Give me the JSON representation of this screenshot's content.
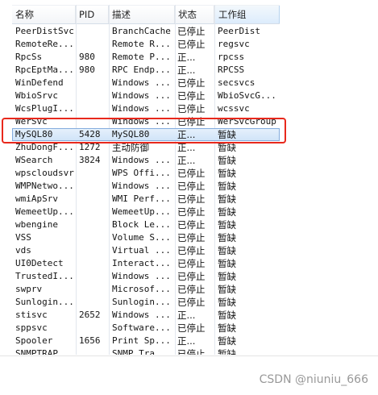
{
  "columns": {
    "name": "名称",
    "pid": "PID",
    "desc": "描述",
    "status": "状态",
    "group": "工作组"
  },
  "services": [
    {
      "name": "PeerDistSvc",
      "pid": "",
      "desc": "BranchCache",
      "status": "已停止",
      "group": "PeerDist"
    },
    {
      "name": "RemoteRe...",
      "pid": "",
      "desc": "Remote R...",
      "status": "已停止",
      "group": "regsvc"
    },
    {
      "name": "RpcSs",
      "pid": "980",
      "desc": "Remote P...",
      "status": "正...",
      "group": "rpcss"
    },
    {
      "name": "RpcEptMa...",
      "pid": "980",
      "desc": "RPC Endp...",
      "status": "正...",
      "group": "RPCSS"
    },
    {
      "name": "WinDefend",
      "pid": "",
      "desc": "Windows ...",
      "status": "已停止",
      "group": "secsvcs"
    },
    {
      "name": "WbioSrvc",
      "pid": "",
      "desc": "Windows ...",
      "status": "已停止",
      "group": "WbioSvcG..."
    },
    {
      "name": "WcsPlugI...",
      "pid": "",
      "desc": "Windows ...",
      "status": "已停止",
      "group": "wcssvc"
    },
    {
      "name": "WerSvc",
      "pid": "",
      "desc": "Windows ...",
      "status": "已停止",
      "group": "WerSvcGroup"
    },
    {
      "name": "MySQL80",
      "pid": "5428",
      "desc": "MySQL80",
      "status": "正...",
      "group": "暂缺"
    },
    {
      "name": "ZhuDongF...",
      "pid": "1272",
      "desc": "主动防御",
      "status": "正...",
      "group": "暂缺"
    },
    {
      "name": "WSearch",
      "pid": "3824",
      "desc": "Windows ...",
      "status": "正...",
      "group": "暂缺"
    },
    {
      "name": "wpscloudsvr",
      "pid": "",
      "desc": "WPS Offi...",
      "status": "已停止",
      "group": "暂缺"
    },
    {
      "name": "WMPNetwo...",
      "pid": "",
      "desc": "Windows ...",
      "status": "已停止",
      "group": "暂缺"
    },
    {
      "name": "wmiApSrv",
      "pid": "",
      "desc": "WMI Perf...",
      "status": "已停止",
      "group": "暂缺"
    },
    {
      "name": "WemeetUp...",
      "pid": "",
      "desc": "WemeetUp...",
      "status": "已停止",
      "group": "暂缺"
    },
    {
      "name": "wbengine",
      "pid": "",
      "desc": "Block Le...",
      "status": "已停止",
      "group": "暂缺"
    },
    {
      "name": "VSS",
      "pid": "",
      "desc": "Volume S...",
      "status": "已停止",
      "group": "暂缺"
    },
    {
      "name": "vds",
      "pid": "",
      "desc": "Virtual ...",
      "status": "已停止",
      "group": "暂缺"
    },
    {
      "name": "UI0Detect",
      "pid": "",
      "desc": "Interact...",
      "status": "已停止",
      "group": "暂缺"
    },
    {
      "name": "TrustedI...",
      "pid": "",
      "desc": "Windows ...",
      "status": "已停止",
      "group": "暂缺"
    },
    {
      "name": "swprv",
      "pid": "",
      "desc": "Microsof...",
      "status": "已停止",
      "group": "暂缺"
    },
    {
      "name": "Sunlogin...",
      "pid": "",
      "desc": "Sunlogin...",
      "status": "已停止",
      "group": "暂缺"
    },
    {
      "name": "stisvc",
      "pid": "2652",
      "desc": "Windows ...",
      "status": "正...",
      "group": "暂缺"
    },
    {
      "name": "sppsvc",
      "pid": "",
      "desc": "Software...",
      "status": "已停止",
      "group": "暂缺"
    },
    {
      "name": "Spooler",
      "pid": "1656",
      "desc": "Print Sp...",
      "status": "正...",
      "group": "暂缺"
    },
    {
      "name": "SNMPTRAP",
      "pid": "",
      "desc": "SNMP Tra...",
      "status": "已停止",
      "group": "暂缺"
    }
  ],
  "selected_service": "MySQL80",
  "watermark": "CSDN @niuniu_666",
  "colors": {
    "highlight_border": "#e8281c",
    "selection_fill": "#cfe3f8",
    "selection_border": "#84acdd"
  }
}
